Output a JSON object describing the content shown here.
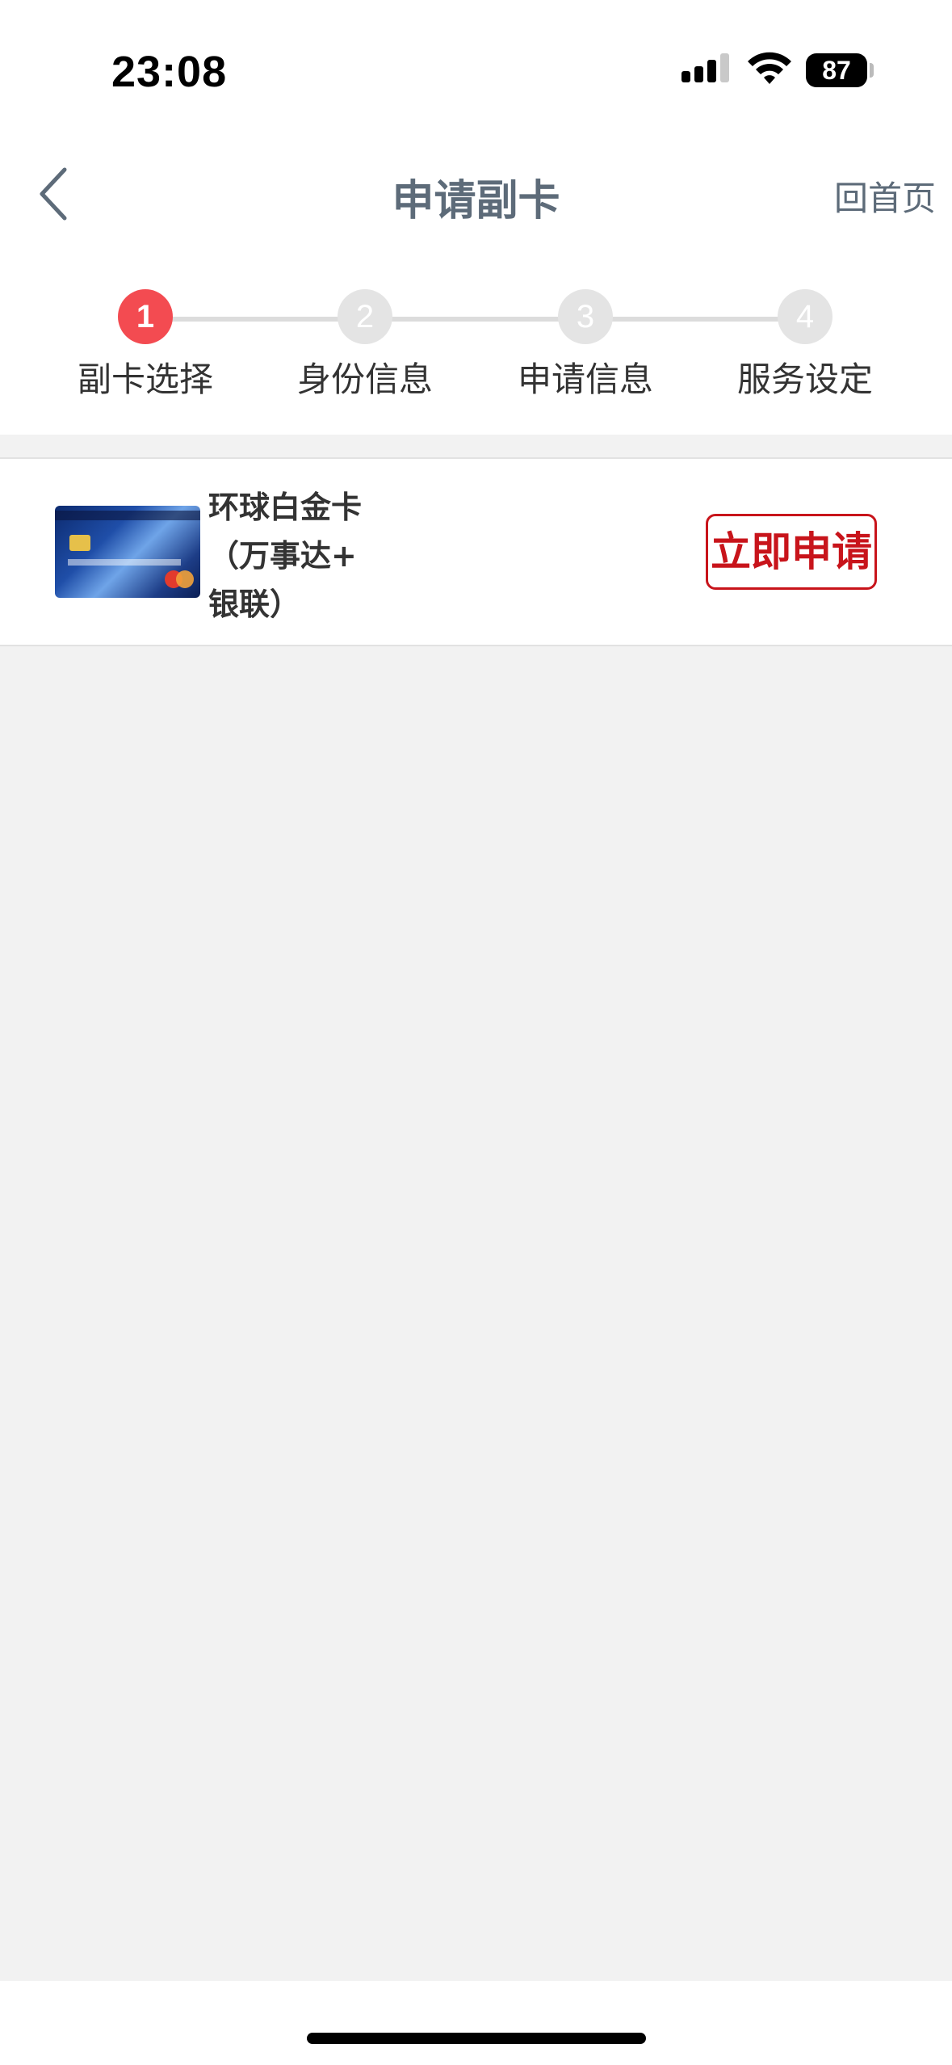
{
  "status_bar": {
    "time": "23:08",
    "battery": "87"
  },
  "nav": {
    "title": "申请副卡",
    "home_label": "回首页"
  },
  "steps": [
    {
      "number": "1",
      "label": "副卡选择",
      "active": true
    },
    {
      "number": "2",
      "label": "身份信息",
      "active": false
    },
    {
      "number": "3",
      "label": "申请信息",
      "active": false
    },
    {
      "number": "4",
      "label": "服务设定",
      "active": false
    }
  ],
  "card": {
    "name_line1": "环球白金卡",
    "name_line2": "（万事达+",
    "name_line3": "银联）",
    "apply_label": "立即申请"
  },
  "colors": {
    "accent": "#c8141b",
    "active_step": "#f34b51",
    "title": "#5d6b79"
  }
}
